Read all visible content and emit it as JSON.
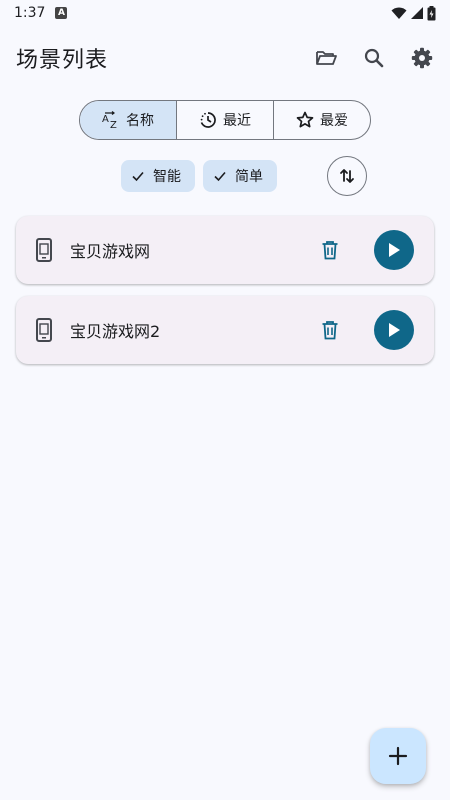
{
  "status_bar": {
    "time": "1:37",
    "notification_letter": "A"
  },
  "app_bar": {
    "title": "场景列表",
    "actions": [
      "folder-open-icon",
      "search-icon",
      "settings-icon"
    ]
  },
  "sort_tabs": [
    {
      "label": "名称",
      "icon": "sort-az-icon",
      "selected": true
    },
    {
      "label": "最近",
      "icon": "recent-clock-icon",
      "selected": false
    },
    {
      "label": "最爱",
      "icon": "star-icon",
      "selected": false
    }
  ],
  "filter_chips": [
    {
      "label": "智能",
      "checked": true
    },
    {
      "label": "简单",
      "checked": true
    }
  ],
  "sort_order_button": {
    "icon": "swap-vertical-icon"
  },
  "scenes": [
    {
      "name": "宝贝游戏网",
      "icon": "phone-icon"
    },
    {
      "name": "宝贝游戏网2",
      "icon": "phone-icon"
    }
  ],
  "fab": {
    "icon": "plus-icon"
  },
  "colors": {
    "background": "#F8F9FE",
    "selected_tab": "#D4E4F6",
    "chip": "#D4E4F6",
    "card": "#F4EFF6",
    "play_button": "#0F6789",
    "delete_icon": "#0F6789",
    "fab": "#CBE6FF"
  }
}
